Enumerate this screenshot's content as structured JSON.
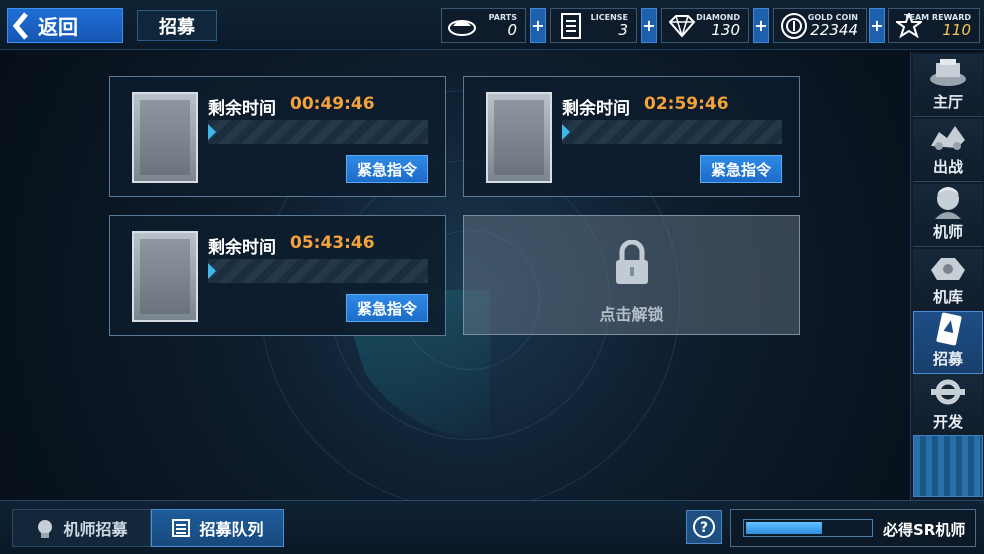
{
  "header": {
    "back_label": "返回",
    "page_title": "招募",
    "resources": [
      {
        "caption": "PARTS",
        "value": "0",
        "icon": "parts-icon"
      },
      {
        "caption": "LICENSE",
        "value": "3",
        "icon": "license-icon"
      },
      {
        "caption": "DIAMOND",
        "value": "130",
        "icon": "diamond-icon"
      },
      {
        "caption": "GOLD COIN",
        "value": "22344",
        "icon": "gold-coin-icon"
      },
      {
        "caption": "TEAM REWARD",
        "value": "110",
        "icon": "team-reward-icon",
        "value_color": "#f2c94c"
      }
    ]
  },
  "sidebar": {
    "items": [
      {
        "label": "主厅",
        "icon": "main-hall-icon"
      },
      {
        "label": "出战",
        "icon": "battle-icon"
      },
      {
        "label": "机师",
        "icon": "pilot-icon"
      },
      {
        "label": "机库",
        "icon": "hangar-icon"
      },
      {
        "label": "招募",
        "icon": "recruit-icon",
        "active": true
      },
      {
        "label": "开发",
        "icon": "develop-icon"
      }
    ]
  },
  "recruit_slots": [
    {
      "remain_label": "剩余时间",
      "time": "00:49:46",
      "button_label": "紧急指令"
    },
    {
      "remain_label": "剩余时间",
      "time": "02:59:46",
      "button_label": "紧急指令"
    },
    {
      "remain_label": "剩余时间",
      "time": "05:43:46",
      "button_label": "紧急指令"
    }
  ],
  "locked_slot": {
    "label": "点击解锁",
    "icon": "lock-icon"
  },
  "bottom": {
    "tabs": [
      {
        "label": "机师招募",
        "icon": "pilot-head-icon",
        "active": false
      },
      {
        "label": "招募队列",
        "icon": "list-icon",
        "active": true
      }
    ],
    "help_label": "?",
    "sr_label": "必得SR机师",
    "sr_progress": 0.62
  },
  "colors": {
    "accent": "#1f6fd6",
    "timer": "#f4a23a",
    "team_reward": "#f2c94c"
  }
}
